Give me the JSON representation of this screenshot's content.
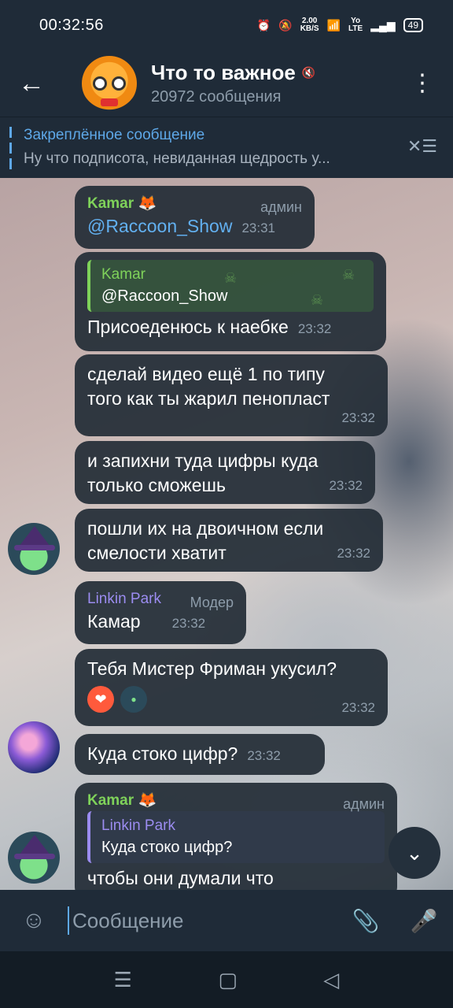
{
  "status": {
    "time": "00:32:56",
    "net_speed": "2.00\nKB/S",
    "network": "Yo\nLTE",
    "battery": "49"
  },
  "header": {
    "title": "Что то важное",
    "subtitle": "20972 сообщения"
  },
  "pinned": {
    "title": "Закреплённое сообщение",
    "text": "Ну что подписота, невиданная щедрость у..."
  },
  "messages": [
    {
      "sender": "Kamar",
      "role": "админ",
      "text": "@Raccoon_Show",
      "time": "23:31"
    },
    {
      "reply_name": "Kamar",
      "reply_text": "@Raccoon_Show",
      "text": "Присоеденюсь к наебке",
      "time": "23:32"
    },
    {
      "text_line1": "сделай видео ещё 1 по типу",
      "text_line2": "того как ты жарил пенопласт",
      "time": "23:32"
    },
    {
      "text_line1": "и запихни туда цифры куда",
      "text_line2": "только сможешь",
      "time": "23:32"
    },
    {
      "text_line1": "пошли их на двоичном если",
      "text_line2": "смелости хватит",
      "time": "23:32"
    },
    {
      "sender": "Linkin Park",
      "role": "Модер",
      "text": "Камар",
      "time": "23:32"
    },
    {
      "text": "Тебя Мистер Фриман укусил?",
      "time": "23:32"
    },
    {
      "text": "Куда стоко цифр?",
      "time": "23:32"
    },
    {
      "sender": "Kamar",
      "role": "админ",
      "reply_name": "Linkin Park",
      "reply_text": "Куда стоко цифр?",
      "text": "чтобы они думали что"
    }
  ],
  "input": {
    "placeholder": "Сообщение"
  },
  "icons": {
    "back": "arrow-left-icon",
    "menu": "more-vertical-icon",
    "emoji": "emoji-icon",
    "attach": "paperclip-icon",
    "mic": "microphone-icon"
  }
}
